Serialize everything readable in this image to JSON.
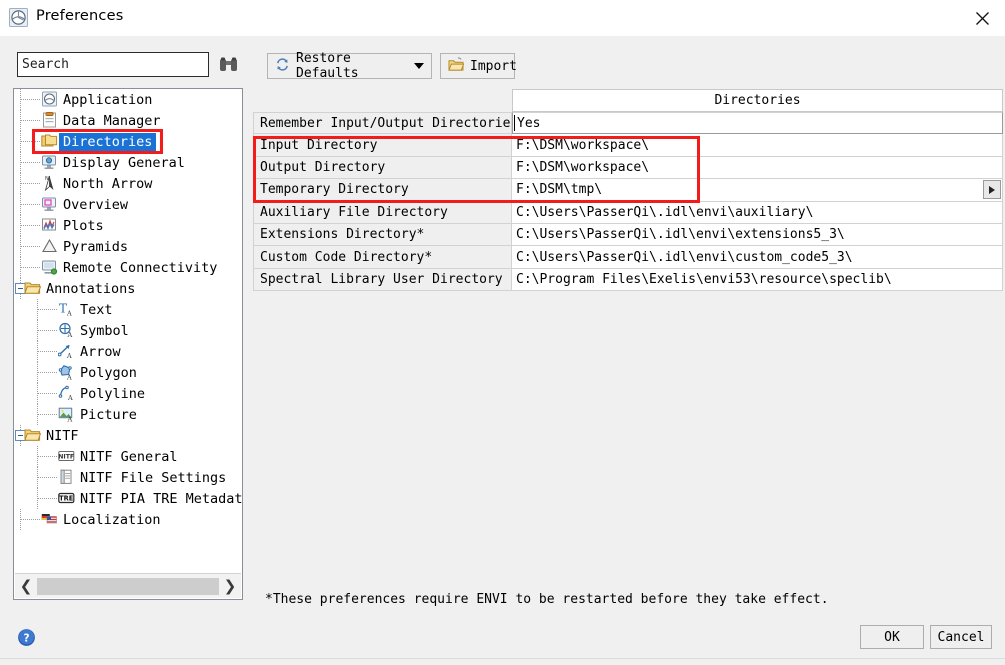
{
  "window": {
    "title": "Preferences",
    "app_icon": "envi-app-icon",
    "close_icon": "close-icon"
  },
  "toolbar": {
    "search": {
      "value": "",
      "placeholder": "Search",
      "icon": "binoculars-icon"
    },
    "restore_defaults": {
      "label": "Restore Defaults",
      "icon": "refresh-icon",
      "has_dropdown": true
    },
    "import": {
      "label": "Import",
      "icon": "open-folder-icon"
    }
  },
  "tree": {
    "items": [
      {
        "label": "Application",
        "icon": "application-icon",
        "depth": 1,
        "selected": false,
        "expander": "none"
      },
      {
        "label": "Data Manager",
        "icon": "data-manager-icon",
        "depth": 1,
        "selected": false,
        "expander": "none"
      },
      {
        "label": "Directories",
        "icon": "folders-icon",
        "depth": 1,
        "selected": true,
        "expander": "none"
      },
      {
        "label": "Display General",
        "icon": "display-icon",
        "depth": 1,
        "selected": false,
        "expander": "none"
      },
      {
        "label": "North Arrow",
        "icon": "north-arrow-icon",
        "depth": 1,
        "selected": false,
        "expander": "none"
      },
      {
        "label": "Overview",
        "icon": "overview-icon",
        "depth": 1,
        "selected": false,
        "expander": "none"
      },
      {
        "label": "Plots",
        "icon": "plots-icon",
        "depth": 1,
        "selected": false,
        "expander": "none"
      },
      {
        "label": "Pyramids",
        "icon": "pyramids-icon",
        "depth": 1,
        "selected": false,
        "expander": "none"
      },
      {
        "label": "Remote Connectivity",
        "icon": "remote-connectivity-icon",
        "depth": 1,
        "selected": false,
        "expander": "none"
      },
      {
        "label": "Annotations",
        "icon": "folder-icon",
        "depth": 0,
        "selected": false,
        "expander": "minus"
      },
      {
        "label": "Text",
        "icon": "text-annotation-icon",
        "depth": 2,
        "selected": false,
        "expander": "none"
      },
      {
        "label": "Symbol",
        "icon": "symbol-annotation-icon",
        "depth": 2,
        "selected": false,
        "expander": "none"
      },
      {
        "label": "Arrow",
        "icon": "arrow-annotation-icon",
        "depth": 2,
        "selected": false,
        "expander": "none"
      },
      {
        "label": "Polygon",
        "icon": "polygon-annotation-icon",
        "depth": 2,
        "selected": false,
        "expander": "none"
      },
      {
        "label": "Polyline",
        "icon": "polyline-annotation-icon",
        "depth": 2,
        "selected": false,
        "expander": "none"
      },
      {
        "label": "Picture",
        "icon": "picture-annotation-icon",
        "depth": 2,
        "selected": false,
        "expander": "none"
      },
      {
        "label": "NITF",
        "icon": "folder-icon",
        "depth": 0,
        "selected": false,
        "expander": "minus"
      },
      {
        "label": "NITF General",
        "icon": "nitf-icon",
        "depth": 2,
        "selected": false,
        "expander": "none"
      },
      {
        "label": "NITF File Settings",
        "icon": "nitf-file-icon",
        "depth": 2,
        "selected": false,
        "expander": "none"
      },
      {
        "label": "NITF PIA TRE Metadata",
        "icon": "tre-icon",
        "depth": 2,
        "selected": false,
        "expander": "none"
      },
      {
        "label": "Localization",
        "icon": "localization-icon",
        "depth": 1,
        "selected": false,
        "expander": "none"
      }
    ],
    "hscrollbar": {
      "left_arrow": "❮",
      "right_arrow": "❯"
    }
  },
  "table": {
    "column_header": "Directories",
    "rows": [
      {
        "key": "Remember Input/Output Directories",
        "value": "Yes",
        "editing": true,
        "highlighted": false
      },
      {
        "key": "Input Directory",
        "value": "F:\\DSM\\workspace\\",
        "editing": false,
        "highlighted": true
      },
      {
        "key": "Output Directory",
        "value": "F:\\DSM\\workspace\\",
        "editing": false,
        "highlighted": true
      },
      {
        "key": "Temporary Directory",
        "value": "F:\\DSM\\tmp\\",
        "editing": false,
        "highlighted": true,
        "scroll_arrow": true
      },
      {
        "key": "Auxiliary File Directory",
        "value": "C:\\Users\\PasserQi\\.idl\\envi\\auxiliary\\",
        "editing": false,
        "highlighted": false
      },
      {
        "key": "Extensions Directory*",
        "value": "C:\\Users\\PasserQi\\.idl\\envi\\extensions5_3\\",
        "editing": false,
        "highlighted": false
      },
      {
        "key": "Custom Code Directory*",
        "value": "C:\\Users\\PasserQi\\.idl\\envi\\custom_code5_3\\",
        "editing": false,
        "highlighted": false
      },
      {
        "key": "Spectral Library User Directory",
        "value": "C:\\Program Files\\Exelis\\envi53\\resource\\speclib\\",
        "editing": false,
        "highlighted": false
      }
    ]
  },
  "footer": {
    "note": "*These preferences require ENVI to be restarted before they take effect.",
    "ok_label": "OK",
    "cancel_label": "Cancel",
    "help_icon": "help-icon"
  },
  "colors": {
    "annotation_red": "#f41b1b",
    "selection_blue": "#1a73d4",
    "window_bg": "#f0f0f0",
    "panel_bg": "#ffffff"
  }
}
